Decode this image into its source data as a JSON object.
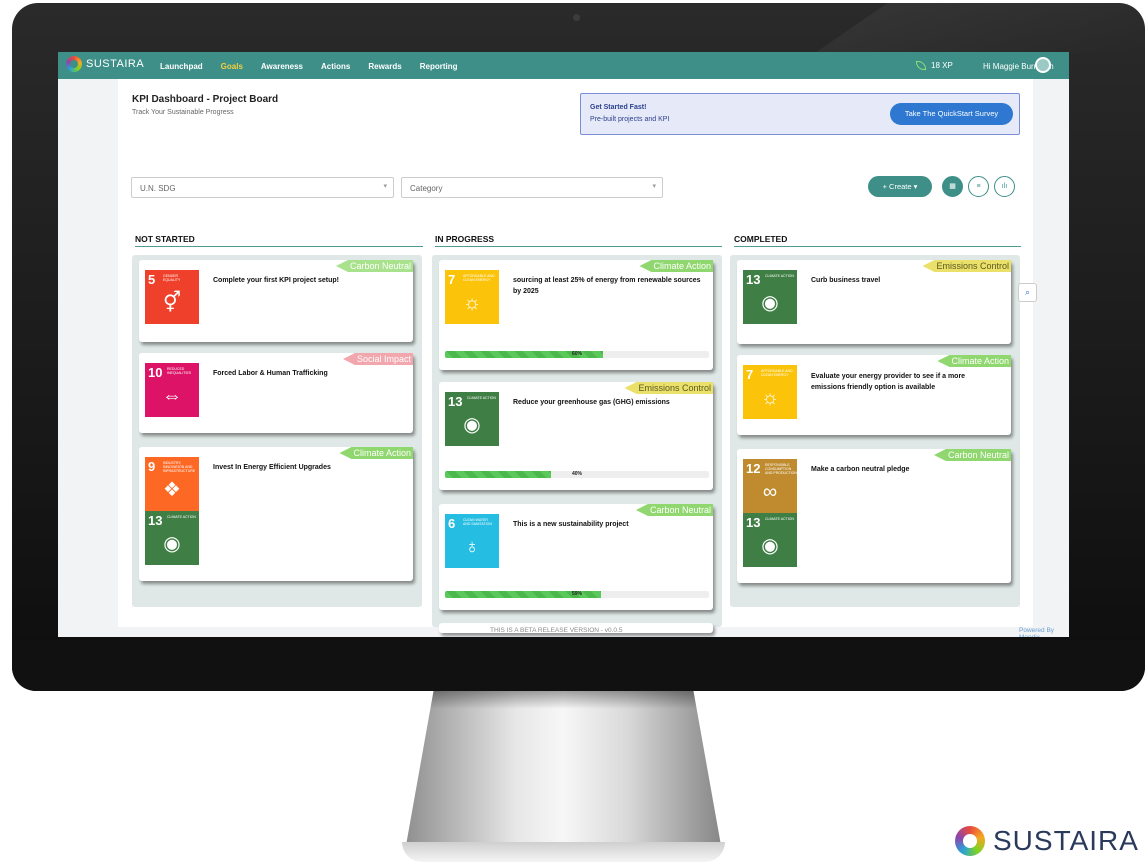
{
  "app": {
    "brand": "SUSTAIRA",
    "nav": [
      "Launchpad",
      "Goals",
      "Awareness",
      "Actions",
      "Rewards",
      "Reporting"
    ],
    "active_nav": "Goals",
    "xp": "18 XP",
    "greeting": "Hi Maggie Burnham"
  },
  "header": {
    "title": "KPI Dashboard - Project Board",
    "subtitle": "Track Your Sustainable Progress"
  },
  "quickstart": {
    "title": "Get Started Fast!",
    "subtitle": "Pre-built projects and KPI",
    "button": "Take The QuickStart Survey"
  },
  "filters": {
    "sdg_placeholder": "U.N. SDG",
    "category_placeholder": "Category"
  },
  "toolbar": {
    "create_label": "Create"
  },
  "columns": {
    "not_started": "NOT STARTED",
    "in_progress": "IN PROGRESS",
    "completed": "COMPLETED"
  },
  "cards": {
    "ns1": {
      "tag": "Carbon Neutral",
      "title": "Complete your first KPI project setup!",
      "sdg_num": "5",
      "sdg_label": "Gender Equality"
    },
    "ns2": {
      "tag": "Social Impact",
      "title": "Forced Labor & Human Trafficking",
      "sdg_num": "10",
      "sdg_label": "Reduced Inequalities"
    },
    "ns3": {
      "tag": "Climate Action",
      "title": "Invest In Energy Efficient Upgrades",
      "sdg_num": "9",
      "sdg_label": "Industry, Innovation and Infrastructure",
      "sdg2_num": "13",
      "sdg2_label": "Climate Action"
    },
    "ip1": {
      "tag": "Climate Action",
      "title": "sourcing at least 25% of energy from renewable sources by 2025",
      "sdg_num": "7",
      "sdg_label": "Affordable and Clean Energy",
      "progress": 60,
      "progress_label": "60%"
    },
    "ip2": {
      "tag": "Emissions Control",
      "title": "Reduce your greenhouse gas (GHG) emissions",
      "sdg_num": "13",
      "sdg_label": "Climate Action",
      "progress": 40,
      "progress_label": "40%"
    },
    "ip3": {
      "tag": "Carbon Neutral",
      "title": "This is a new sustainability project",
      "sdg_num": "6",
      "sdg_label": "Clean Water and Sanitation",
      "progress": 59,
      "progress_label": "59%"
    },
    "c1": {
      "tag": "Emissions Control",
      "title": "Curb business travel",
      "sdg_num": "13",
      "sdg_label": "Climate Action"
    },
    "c2": {
      "tag": "Climate Action",
      "title": "Evaluate your energy provider to see if a more emissions friendly option is available",
      "sdg_num": "7",
      "sdg_label": "Affordable and Clean Energy"
    },
    "c3": {
      "tag": "Carbon Neutral",
      "title": "Make a carbon neutral pledge",
      "sdg_num": "12",
      "sdg_label": "Responsible Consumption and Production",
      "sdg2_num": "13",
      "sdg2_label": "Climate Action"
    }
  },
  "footer": {
    "beta": "THIS IS A BETA RELEASE VERSION - v0.0.5",
    "powered": "Powered By Mendix"
  },
  "colors": {
    "teal": "#3d8f88",
    "sdg5": "#ef402b",
    "sdg6": "#26bde2",
    "sdg7": "#fcc30b",
    "sdg9": "#fd6925",
    "sdg10": "#dd1367",
    "sdg12": "#bf8b2e",
    "sdg13": "#3f7e44"
  },
  "icons": {
    "sdg5": "gender-symbol-icon",
    "sdg6": "water-drop-icon",
    "sdg7": "sun-power-icon",
    "sdg9": "cubes-icon",
    "sdg10": "equality-arrows-icon",
    "sdg12": "infinity-icon",
    "sdg13": "eye-globe-icon"
  }
}
